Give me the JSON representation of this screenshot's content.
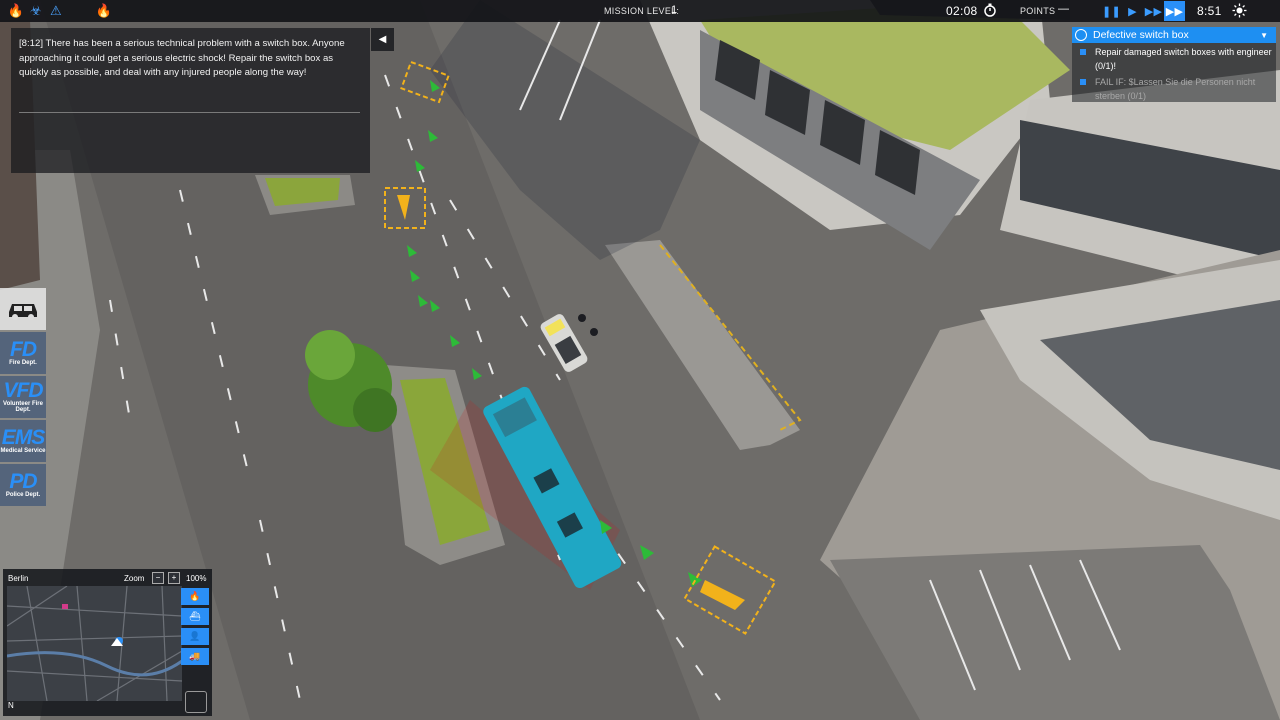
{
  "topbar": {
    "alert_icons": [
      "fire-alert-icon",
      "biohazard-alert-icon",
      "police-alert-icon",
      "fire-alert-icon"
    ],
    "mission_level_label": "MISSION LEVEL:",
    "mission_level": "1",
    "elapsed_time": "02:08",
    "points_label": "POINTS",
    "points_value": "—",
    "speed_controls": [
      "pause",
      "play",
      "fast",
      "fastest"
    ],
    "speed_glyphs": [
      "❚❚",
      "▶",
      "▶▶",
      "▶▶"
    ],
    "active_speed": "fastest",
    "game_time": "8:51"
  },
  "message": {
    "text": "[8:12] There has been a serious technical problem with a switch box. Anyone approaching it could get a serious electric shock! Repair the switch box as quickly as possible, and deal with any injured people along the way!",
    "collapse_glyph": "◀"
  },
  "objective": {
    "title": "Defective switch box",
    "dropdown_glyph": "▼",
    "tasks": [
      {
        "text": "Repair damaged switch boxes with engineer (0/1)!",
        "state": "active"
      },
      {
        "text": "FAIL IF: $Lassen Sie die Personen nicht sterben (0/1)",
        "state": "fail"
      }
    ]
  },
  "sidebar": {
    "items": [
      {
        "id": "vehicles",
        "big": "",
        "small": "",
        "icon": "car-icon"
      },
      {
        "id": "fd",
        "big": "FD",
        "small": "Fire Dept."
      },
      {
        "id": "vfd",
        "big": "VFD",
        "small": "Volunteer Fire Dept."
      },
      {
        "id": "ems",
        "big": "EMS",
        "small": "Medical Service"
      },
      {
        "id": "pd",
        "big": "PD",
        "small": "Police Dept."
      }
    ]
  },
  "minimap": {
    "city": "Berlin",
    "zoom_label": "Zoom",
    "zoom_minus": "−",
    "zoom_plus": "+",
    "zoom_value": "100%",
    "compass": "N",
    "tools": [
      "fire-icon",
      "ship-icon",
      "person-icon",
      "truck-icon"
    ]
  },
  "colors": {
    "accent": "#2a8ff7",
    "objective_header": "#1e8ff2",
    "bus": "#1fa7c4",
    "route_arrows": "#2dbb38",
    "marker": "#f2b21b"
  }
}
